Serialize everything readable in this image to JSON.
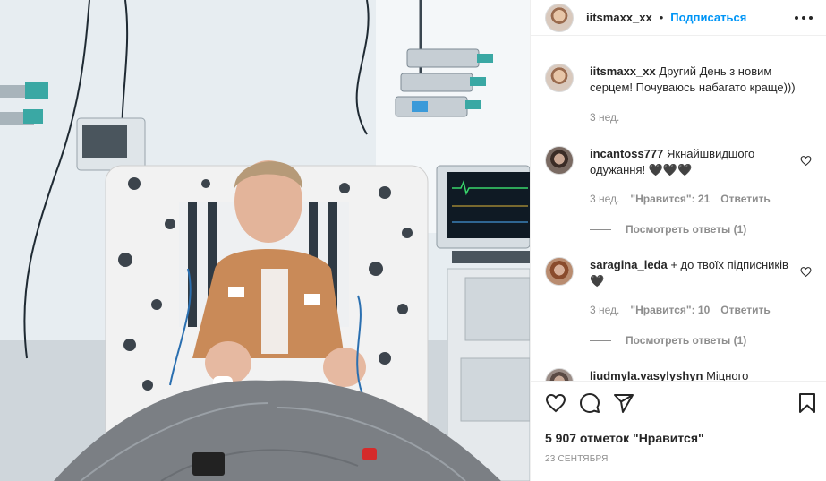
{
  "post": {
    "username": "iitsmaxx_xx",
    "separator": "•",
    "follow_label": "Подписаться",
    "caption_user": "iitsmaxx_xx",
    "caption_text": "Другий День з новим серцем! Почуваюсь набагато краще)))",
    "caption_time": "3 нед."
  },
  "comments": [
    {
      "user": "incantoss777",
      "text": "Якнайшвидшого одужання! 🖤🖤🖤",
      "time": "3 нед.",
      "likes": "\"Нравится\": 21",
      "reply": "Ответить",
      "view_replies": "Посмотреть ответы (1)"
    },
    {
      "user": "saragina_leda",
      "text": "+ до твоїх підписників 🖤",
      "time": "3 нед.",
      "likes": "\"Нравится\": 10",
      "reply": "Ответить",
      "view_replies": "Посмотреть ответы (1)"
    },
    {
      "user": "liudmyla.vasylyshyn",
      "text": "Міцного"
    }
  ],
  "footer": {
    "likes_count": "5 907 отметок \"Нравится\"",
    "date": "23 СЕНТЯБРЯ"
  },
  "icons": [
    "heart-icon",
    "comment-icon",
    "share-icon",
    "bookmark-icon",
    "more-icon"
  ]
}
